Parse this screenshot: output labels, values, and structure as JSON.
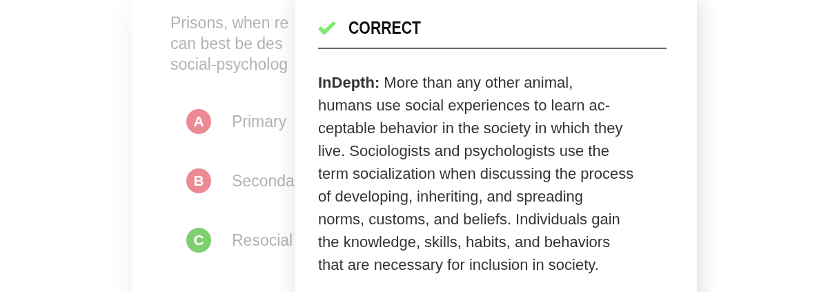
{
  "question": {
    "text": "Prisons, when re\ncan best be des\nsocial-psycholog",
    "options": [
      {
        "letter": "A",
        "text": "Primary",
        "correct": false
      },
      {
        "letter": "B",
        "text": "Seconda",
        "correct": false
      },
      {
        "letter": "C",
        "text": "Resocial",
        "correct": true
      }
    ]
  },
  "feedback": {
    "result": "CORRECT",
    "correct": true,
    "text": "**InDepth:** More than any other animal,\nhumans use social experiences to learn ac-\nceptable behavior in the society in which they\nlive. Sociologists and psychologists use the\nterm socialization when discussing the process\nof developing, inheriting, and spreading\nnorms, customs, and beliefs. Individuals gain\nthe knowledge, skills, habits, and behaviors\nthat are necessary for inclusion in society."
  }
}
